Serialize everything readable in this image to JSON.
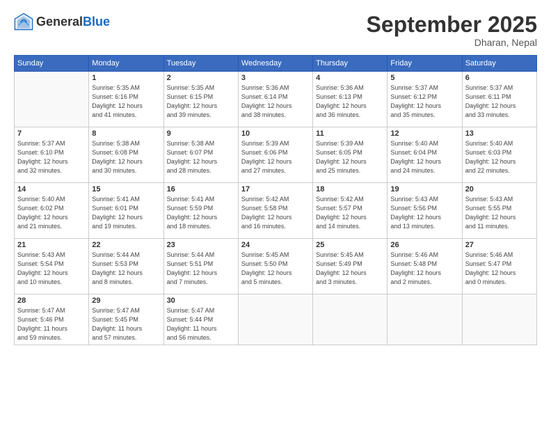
{
  "header": {
    "logo_general": "General",
    "logo_blue": "Blue",
    "month_title": "September 2025",
    "location": "Dharan, Nepal"
  },
  "days_of_week": [
    "Sunday",
    "Monday",
    "Tuesday",
    "Wednesday",
    "Thursday",
    "Friday",
    "Saturday"
  ],
  "weeks": [
    [
      {
        "day": "",
        "info": ""
      },
      {
        "day": "1",
        "info": "Sunrise: 5:35 AM\nSunset: 6:16 PM\nDaylight: 12 hours\nand 41 minutes."
      },
      {
        "day": "2",
        "info": "Sunrise: 5:35 AM\nSunset: 6:15 PM\nDaylight: 12 hours\nand 39 minutes."
      },
      {
        "day": "3",
        "info": "Sunrise: 5:36 AM\nSunset: 6:14 PM\nDaylight: 12 hours\nand 38 minutes."
      },
      {
        "day": "4",
        "info": "Sunrise: 5:36 AM\nSunset: 6:13 PM\nDaylight: 12 hours\nand 36 minutes."
      },
      {
        "day": "5",
        "info": "Sunrise: 5:37 AM\nSunset: 6:12 PM\nDaylight: 12 hours\nand 35 minutes."
      },
      {
        "day": "6",
        "info": "Sunrise: 5:37 AM\nSunset: 6:11 PM\nDaylight: 12 hours\nand 33 minutes."
      }
    ],
    [
      {
        "day": "7",
        "info": "Sunrise: 5:37 AM\nSunset: 6:10 PM\nDaylight: 12 hours\nand 32 minutes."
      },
      {
        "day": "8",
        "info": "Sunrise: 5:38 AM\nSunset: 6:08 PM\nDaylight: 12 hours\nand 30 minutes."
      },
      {
        "day": "9",
        "info": "Sunrise: 5:38 AM\nSunset: 6:07 PM\nDaylight: 12 hours\nand 28 minutes."
      },
      {
        "day": "10",
        "info": "Sunrise: 5:39 AM\nSunset: 6:06 PM\nDaylight: 12 hours\nand 27 minutes."
      },
      {
        "day": "11",
        "info": "Sunrise: 5:39 AM\nSunset: 6:05 PM\nDaylight: 12 hours\nand 25 minutes."
      },
      {
        "day": "12",
        "info": "Sunrise: 5:40 AM\nSunset: 6:04 PM\nDaylight: 12 hours\nand 24 minutes."
      },
      {
        "day": "13",
        "info": "Sunrise: 5:40 AM\nSunset: 6:03 PM\nDaylight: 12 hours\nand 22 minutes."
      }
    ],
    [
      {
        "day": "14",
        "info": "Sunrise: 5:40 AM\nSunset: 6:02 PM\nDaylight: 12 hours\nand 21 minutes."
      },
      {
        "day": "15",
        "info": "Sunrise: 5:41 AM\nSunset: 6:01 PM\nDaylight: 12 hours\nand 19 minutes."
      },
      {
        "day": "16",
        "info": "Sunrise: 5:41 AM\nSunset: 5:59 PM\nDaylight: 12 hours\nand 18 minutes."
      },
      {
        "day": "17",
        "info": "Sunrise: 5:42 AM\nSunset: 5:58 PM\nDaylight: 12 hours\nand 16 minutes."
      },
      {
        "day": "18",
        "info": "Sunrise: 5:42 AM\nSunset: 5:57 PM\nDaylight: 12 hours\nand 14 minutes."
      },
      {
        "day": "19",
        "info": "Sunrise: 5:43 AM\nSunset: 5:56 PM\nDaylight: 12 hours\nand 13 minutes."
      },
      {
        "day": "20",
        "info": "Sunrise: 5:43 AM\nSunset: 5:55 PM\nDaylight: 12 hours\nand 11 minutes."
      }
    ],
    [
      {
        "day": "21",
        "info": "Sunrise: 5:43 AM\nSunset: 5:54 PM\nDaylight: 12 hours\nand 10 minutes."
      },
      {
        "day": "22",
        "info": "Sunrise: 5:44 AM\nSunset: 5:53 PM\nDaylight: 12 hours\nand 8 minutes."
      },
      {
        "day": "23",
        "info": "Sunrise: 5:44 AM\nSunset: 5:51 PM\nDaylight: 12 hours\nand 7 minutes."
      },
      {
        "day": "24",
        "info": "Sunrise: 5:45 AM\nSunset: 5:50 PM\nDaylight: 12 hours\nand 5 minutes."
      },
      {
        "day": "25",
        "info": "Sunrise: 5:45 AM\nSunset: 5:49 PM\nDaylight: 12 hours\nand 3 minutes."
      },
      {
        "day": "26",
        "info": "Sunrise: 5:46 AM\nSunset: 5:48 PM\nDaylight: 12 hours\nand 2 minutes."
      },
      {
        "day": "27",
        "info": "Sunrise: 5:46 AM\nSunset: 5:47 PM\nDaylight: 12 hours\nand 0 minutes."
      }
    ],
    [
      {
        "day": "28",
        "info": "Sunrise: 5:47 AM\nSunset: 5:46 PM\nDaylight: 11 hours\nand 59 minutes."
      },
      {
        "day": "29",
        "info": "Sunrise: 5:47 AM\nSunset: 5:45 PM\nDaylight: 11 hours\nand 57 minutes."
      },
      {
        "day": "30",
        "info": "Sunrise: 5:47 AM\nSunset: 5:44 PM\nDaylight: 11 hours\nand 56 minutes."
      },
      {
        "day": "",
        "info": ""
      },
      {
        "day": "",
        "info": ""
      },
      {
        "day": "",
        "info": ""
      },
      {
        "day": "",
        "info": ""
      }
    ]
  ]
}
